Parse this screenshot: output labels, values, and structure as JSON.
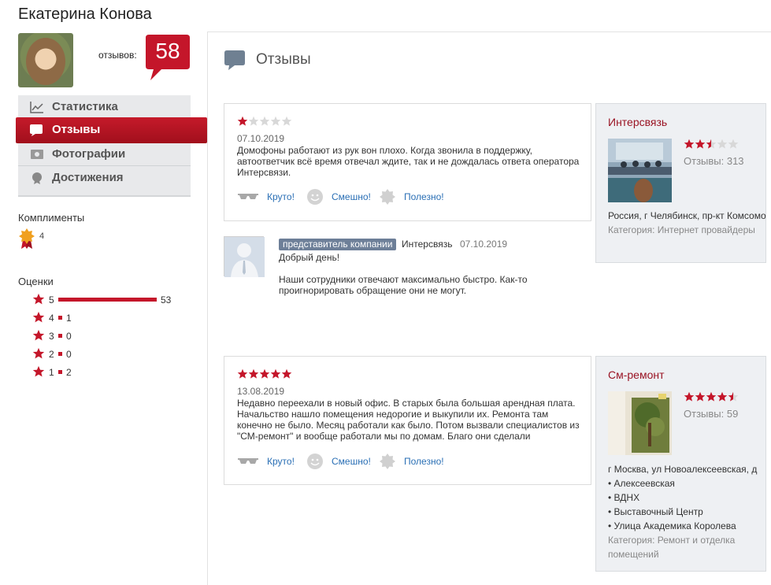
{
  "profile": {
    "name": "Екатерина Конова",
    "reviews_label": "отзывов:",
    "reviews_count": "58"
  },
  "nav": {
    "items": [
      {
        "label": "Статистика",
        "icon": "chart-line-icon",
        "active": false
      },
      {
        "label": "Отзывы",
        "icon": "speech-bubble-icon",
        "active": true
      },
      {
        "label": "Фотографии",
        "icon": "photos-icon",
        "active": false
      },
      {
        "label": "Достижения",
        "icon": "medal-icon",
        "active": false
      }
    ]
  },
  "compliments": {
    "title": "Комплименты",
    "count": "4"
  },
  "ratings": {
    "title": "Оценки",
    "rows": [
      {
        "stars": "5",
        "count": "53",
        "value": 53
      },
      {
        "stars": "4",
        "count": "1",
        "value": 1
      },
      {
        "stars": "3",
        "count": "0",
        "value": 0
      },
      {
        "stars": "2",
        "count": "0",
        "value": 0
      },
      {
        "stars": "1",
        "count": "2",
        "value": 2
      }
    ]
  },
  "page": {
    "title": "Отзывы"
  },
  "reviews": [
    {
      "rating": 1,
      "date": "07.10.2019",
      "text": "Домофоны работают из рук вон плохо. Когда звонила в поддержку, автоответчик всё время отвечал ждите, так и не дождалась ответа оператора Интерсвязи.",
      "reactions": {
        "cool": "Круто!",
        "funny": "Смешно!",
        "useful": "Полезно!"
      },
      "company": {
        "name": "Интерсвязь",
        "rating": 2.5,
        "reviews": "Отзывы: 313",
        "address": "Россия, г Челябинск, пр-кт Комсомольский",
        "category": "Категория: Интернет провайдеры"
      },
      "reply": {
        "badge": "представитель компании",
        "company": "Интерсвязь",
        "date": "07.10.2019",
        "greeting": "Добрый день!",
        "text": "Наши сотрудники отвечают максимально быстро. Как-то проигнорировать обращение они не могут."
      }
    },
    {
      "rating": 5,
      "date": "13.08.2019",
      "text": "Недавно переехали в новый офис. В старых была большая арендная плата. Начальство нашло помещения недорогие и выкупили их. Ремонта там конечно не было. Месяц работали как было. Потом вызвали специалистов из \"СМ-ремонт\" и вообще работали мы по домам. Благо они сделали",
      "reactions": {
        "cool": "Круто!",
        "funny": "Смешно!",
        "useful": "Полезно!"
      },
      "company": {
        "name": "См-ремонт",
        "rating": 4.5,
        "reviews": "Отзывы: 59",
        "address": "г Москва, ул Новоалексеевская, д",
        "metro": [
          "Алексеевская",
          "ВДНХ",
          "Выставочный Центр",
          "Улица Академика Королева"
        ],
        "category": "Категория: Ремонт и отделка помещений"
      }
    }
  ],
  "colors": {
    "brand_red": "#c4162a",
    "link_blue": "#2a6fb5",
    "company_red": "#9a1424"
  }
}
